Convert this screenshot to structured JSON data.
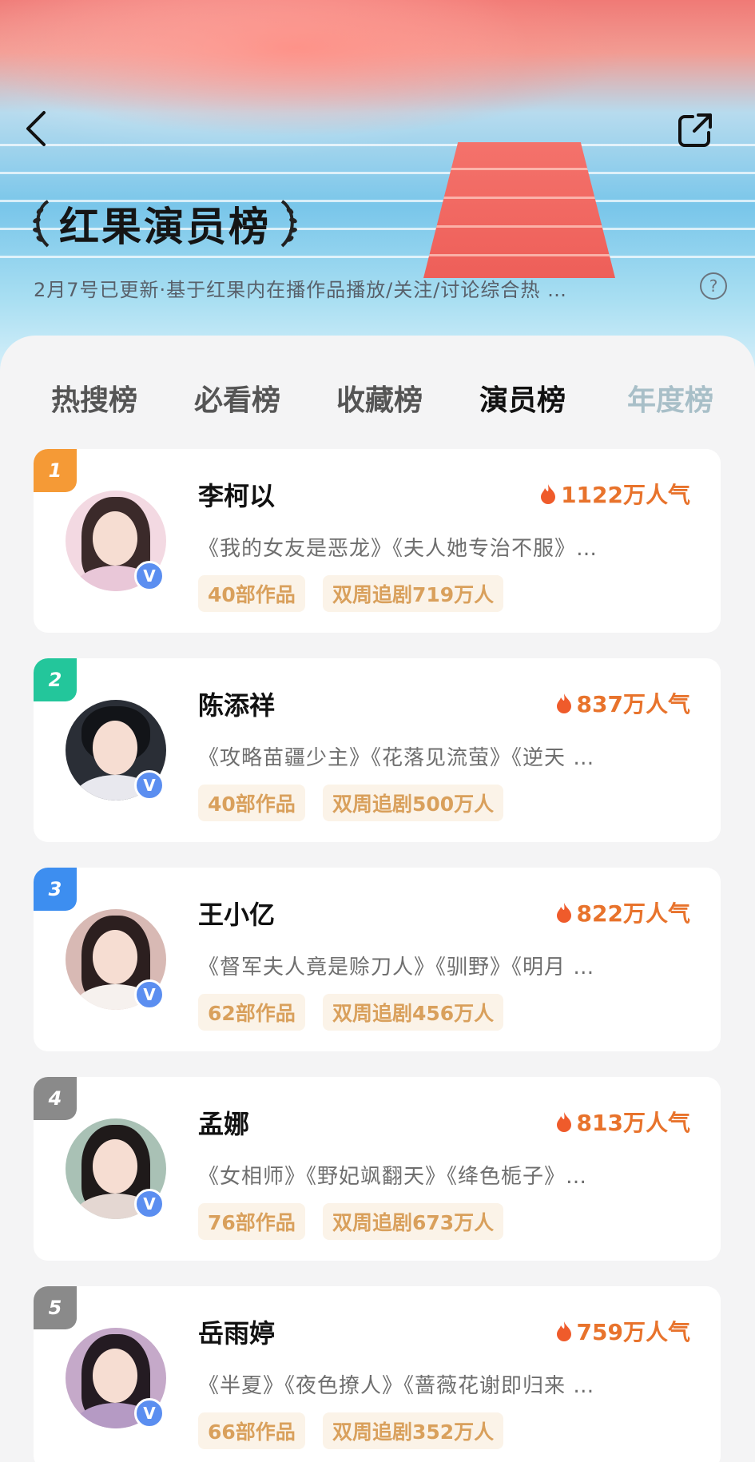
{
  "header": {
    "title": "红果演员榜",
    "subtitle": "2月7号已更新·基于红果内在播作品播放/关注/讨论综合热 …",
    "help": "?"
  },
  "tabs": [
    {
      "label": "热搜榜",
      "active": false
    },
    {
      "label": "必看榜",
      "active": false
    },
    {
      "label": "收藏榜",
      "active": false
    },
    {
      "label": "演员榜",
      "active": true
    },
    {
      "label": "年度榜",
      "active": false
    }
  ],
  "actors": [
    {
      "rank": "1",
      "rank_color": "#f59a36",
      "name": "李柯以",
      "heat": "1122万人气",
      "works": "《我的女友是恶龙》《夫人她专治不服》…",
      "count": "40部作品",
      "follow": "双周追剧719万人"
    },
    {
      "rank": "2",
      "rank_color": "#23c69b",
      "name": "陈添祥",
      "heat": "837万人气",
      "works": "《攻略苗疆少主》《花落见流萤》《逆天 …",
      "count": "40部作品",
      "follow": "双周追剧500万人"
    },
    {
      "rank": "3",
      "rank_color": "#3d8ef0",
      "name": "王小亿",
      "heat": "822万人气",
      "works": "《督军夫人竟是赊刀人》《驯野》《明月 …",
      "count": "62部作品",
      "follow": "双周追剧456万人"
    },
    {
      "rank": "4",
      "rank_color": "#8a8a8a",
      "name": "孟娜",
      "heat": "813万人气",
      "works": "《女相师》《野妃飒翻天》《绛色栀子》…",
      "count": "76部作品",
      "follow": "双周追剧673万人"
    },
    {
      "rank": "5",
      "rank_color": "#8a8a8a",
      "name": "岳雨婷",
      "heat": "759万人气",
      "works": "《半夏》《夜色撩人》《蔷薇花谢即归来 …",
      "count": "66部作品",
      "follow": "双周追剧352万人"
    }
  ]
}
